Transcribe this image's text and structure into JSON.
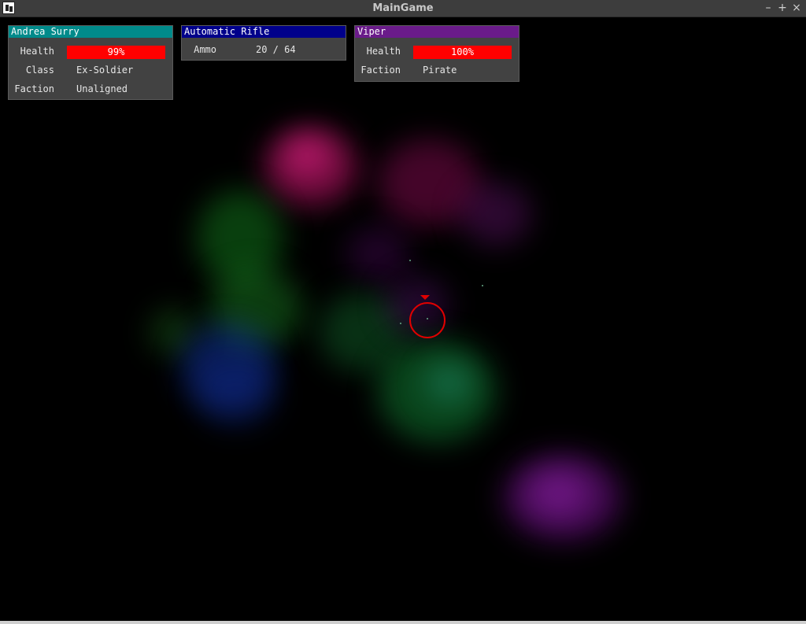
{
  "window": {
    "title": "MainGame",
    "controls": {
      "minimize": "–",
      "maximize": "+",
      "close": "×"
    },
    "app_icon": "app-logo-icon"
  },
  "player": {
    "name": "Andrea Surry",
    "header_color": "#008b8b",
    "health_label": "Health",
    "health_value": "99%",
    "health_fraction": 0.99,
    "class_label": "Class",
    "class_value": "Ex-Soldier",
    "faction_label": "Faction",
    "faction_value": "Unaligned"
  },
  "weapon": {
    "name": "Automatic Rifle",
    "header_color": "#00008b",
    "ammo_label": "Ammo",
    "ammo_value": "20 / 64"
  },
  "target": {
    "name": "Viper",
    "header_color": "#6a1b8a",
    "health_label": "Health",
    "health_value": "100%",
    "health_fraction": 1.0,
    "faction_label": "Faction",
    "faction_value": "Pirate"
  },
  "colors": {
    "health_bar": "#ff0000",
    "panel_bg": "#424242",
    "reticle": "#e00000"
  }
}
